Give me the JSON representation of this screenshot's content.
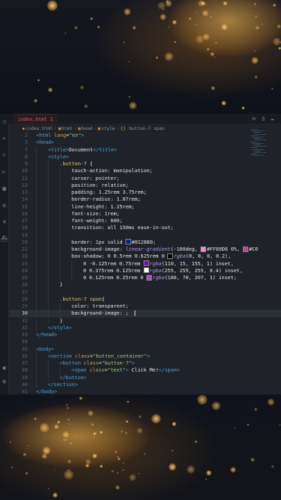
{
  "editor": {
    "tab_label": "index.html 1",
    "breadcrumb": [
      "index.html",
      "html",
      "head",
      "style",
      ".button-7 span"
    ],
    "activity_icons": [
      "files-icon",
      "search-icon",
      "source-control-icon",
      "run-debug-icon",
      "extensions-icon",
      "remote-icon",
      "test-icon",
      "docker-icon",
      "account-icon",
      "settings-icon"
    ],
    "run_icons": [
      "run-icon",
      "split-editor-icon",
      "more-icon"
    ],
    "swatches": {
      "border": "#012880",
      "grad1": "#FF89D6",
      "grad2": "#C03FA0",
      "shadow1": "#000000",
      "shadow2": "#6E0FB4",
      "shadow3": "#FFFFFF",
      "shadow4": "#B446CF"
    },
    "lines": [
      {
        "n": "2",
        "indent": 0,
        "segs": [
          [
            "tag",
            "<html "
          ],
          [
            "attr",
            "lang"
          ],
          [
            "txt",
            "="
          ],
          [
            "str",
            "\"en\""
          ],
          [
            "tag",
            ">"
          ]
        ]
      },
      {
        "n": "3",
        "indent": 0,
        "segs": [
          [
            "tag",
            "<head>"
          ]
        ]
      },
      {
        "n": "7",
        "indent": 1,
        "segs": [
          [
            "tag",
            "<title>"
          ],
          [
            "txt",
            "Document"
          ],
          [
            "tag",
            "</title>"
          ]
        ]
      },
      {
        "n": "8",
        "indent": 1,
        "segs": [
          [
            "tag",
            "<style>"
          ]
        ]
      },
      {
        "n": "9",
        "indent": 2,
        "segs": [
          [
            "sel",
            ".button-7 "
          ],
          [
            "txt",
            "{"
          ]
        ]
      },
      {
        "n": "10",
        "indent": 3,
        "segs": [
          [
            "prop",
            "touch-action: manipulation;"
          ]
        ]
      },
      {
        "n": "11",
        "indent": 3,
        "segs": [
          [
            "prop",
            "cursor: pointer;"
          ]
        ]
      },
      {
        "n": "12",
        "indent": 3,
        "segs": [
          [
            "prop",
            "position: relative;"
          ]
        ]
      },
      {
        "n": "13",
        "indent": 3,
        "segs": [
          [
            "prop",
            "padding: 1.25rem 3.75rem;"
          ]
        ]
      },
      {
        "n": "14",
        "indent": 3,
        "segs": [
          [
            "prop",
            "border-radius: 1.87rem;"
          ]
        ]
      },
      {
        "n": "15",
        "indent": 3,
        "segs": [
          [
            "prop",
            "line-height: 1.25rem;"
          ]
        ]
      },
      {
        "n": "16",
        "indent": 3,
        "segs": [
          [
            "prop",
            "font-size: 1rem;"
          ]
        ]
      },
      {
        "n": "17",
        "indent": 3,
        "segs": [
          [
            "prop",
            "font-weight: 600;"
          ]
        ]
      },
      {
        "n": "18",
        "indent": 3,
        "segs": [
          [
            "prop",
            "transition: all 150ms ease-in-out;"
          ]
        ]
      },
      {
        "n": "19",
        "indent": 3,
        "segs": []
      },
      {
        "n": "20",
        "indent": 3,
        "segs": [
          [
            "prop",
            "border: 1px solid "
          ],
          [
            "swatch",
            "border"
          ],
          [
            "prop",
            "#012880;"
          ]
        ]
      },
      {
        "n": "21",
        "indent": 3,
        "segs": [
          [
            "prop",
            "background-image: "
          ],
          [
            "fn",
            "linear-gradient"
          ],
          [
            "prop",
            "(-180deg, "
          ],
          [
            "swatch",
            "grad1"
          ],
          [
            "prop",
            "#FF89D6 0%, "
          ],
          [
            "swatch",
            "grad2"
          ],
          [
            "prop",
            "#C0"
          ]
        ]
      },
      {
        "n": "22",
        "indent": 3,
        "segs": [
          [
            "prop",
            "box-shadow: 0 0.5rem 0.625rem 0 "
          ],
          [
            "swatch",
            "shadow1"
          ],
          [
            "fn",
            "rgba"
          ],
          [
            "prop",
            "(0, 0, 0, 0.2),"
          ]
        ]
      },
      {
        "n": "23",
        "indent": 4,
        "segs": [
          [
            "prop",
            "0 -0.125rem 0.75rem "
          ],
          [
            "swatch",
            "shadow2"
          ],
          [
            "fn",
            "rgba"
          ],
          [
            "prop",
            "(110, 15, 155, 1) inset,"
          ]
        ]
      },
      {
        "n": "24",
        "indent": 4,
        "segs": [
          [
            "prop",
            "0 0.375rem 0.125rem "
          ],
          [
            "swatch",
            "shadow3"
          ],
          [
            "fn",
            "rgba"
          ],
          [
            "prop",
            "(255, 255, 255, 0.4) inset,"
          ]
        ]
      },
      {
        "n": "25",
        "indent": 4,
        "segs": [
          [
            "prop",
            "0 0.125rem 0.25rem 0 "
          ],
          [
            "swatch",
            "shadow4"
          ],
          [
            "fn",
            "rgba"
          ],
          [
            "prop",
            "(180, 70, 207, 1) inset;"
          ]
        ]
      },
      {
        "n": "26",
        "indent": 2,
        "segs": [
          [
            "txt",
            "}"
          ]
        ]
      },
      {
        "n": "27",
        "indent": 2,
        "segs": []
      },
      {
        "n": "28",
        "indent": 2,
        "segs": [
          [
            "sel",
            ".button-7 span"
          ],
          [
            "txt",
            "{"
          ]
        ]
      },
      {
        "n": "29",
        "indent": 3,
        "segs": [
          [
            "prop",
            "color: transparent;"
          ]
        ]
      },
      {
        "n": "30",
        "indent": 3,
        "segs": [
          [
            "prop",
            "background-image: ;"
          ]
        ],
        "active": true
      },
      {
        "n": "31",
        "indent": 2,
        "segs": [
          [
            "txt",
            "}"
          ]
        ]
      },
      {
        "n": "32",
        "indent": 1,
        "segs": [
          [
            "tag",
            "</style>"
          ]
        ]
      },
      {
        "n": "33",
        "indent": 0,
        "segs": [
          [
            "tag",
            "</head>"
          ]
        ]
      },
      {
        "n": "34",
        "indent": 0,
        "segs": []
      },
      {
        "n": "35",
        "indent": 0,
        "segs": [
          [
            "tag",
            "<body>"
          ]
        ]
      },
      {
        "n": "36",
        "indent": 1,
        "segs": [
          [
            "tag",
            "<section "
          ],
          [
            "attr",
            "class"
          ],
          [
            "txt",
            "="
          ],
          [
            "str",
            "\"button_container\""
          ],
          [
            "tag",
            ">"
          ]
        ]
      },
      {
        "n": "37",
        "indent": 2,
        "segs": [
          [
            "tag",
            "<button "
          ],
          [
            "attr",
            "class"
          ],
          [
            "txt",
            "="
          ],
          [
            "str",
            "\"button-7\""
          ],
          [
            "tag",
            ">"
          ]
        ]
      },
      {
        "n": "38",
        "indent": 3,
        "segs": [
          [
            "tag",
            "<span "
          ],
          [
            "attr",
            "class"
          ],
          [
            "txt",
            "="
          ],
          [
            "str",
            "\"text\""
          ],
          [
            "tag",
            ">"
          ],
          [
            "txt",
            " Click Me!"
          ],
          [
            "tag",
            "</span>"
          ]
        ]
      },
      {
        "n": "39",
        "indent": 2,
        "segs": [
          [
            "tag",
            "</button>"
          ]
        ]
      },
      {
        "n": "40",
        "indent": 1,
        "segs": [
          [
            "tag",
            "</section>"
          ]
        ]
      },
      {
        "n": "41",
        "indent": 0,
        "segs": [
          [
            "tag",
            "</body>"
          ]
        ]
      }
    ]
  }
}
